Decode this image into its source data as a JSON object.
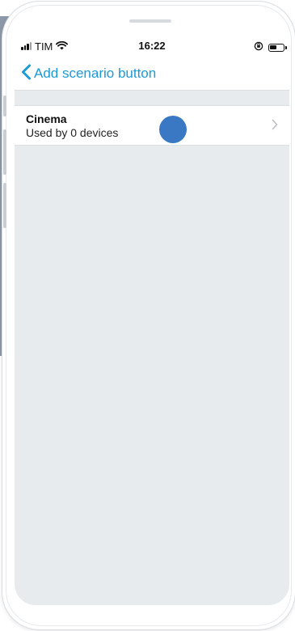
{
  "status_bar": {
    "carrier": "TIM",
    "time": "16:22",
    "icons": [
      "signal-icon",
      "wifi-icon",
      "orientation-lock-icon",
      "battery-icon"
    ]
  },
  "nav": {
    "back_label": "Add scenario button",
    "back_icon": "chevron-left-icon"
  },
  "list": {
    "items": [
      {
        "title": "Cinema",
        "subtitle": "Used by 0 devices",
        "icon": "chevron-right-icon"
      }
    ]
  },
  "colors": {
    "accent": "#1a9ad6",
    "screen_background": "#e8ebed",
    "touch_indicator": "#3a78c4",
    "backdrop": "#8c98a8"
  }
}
